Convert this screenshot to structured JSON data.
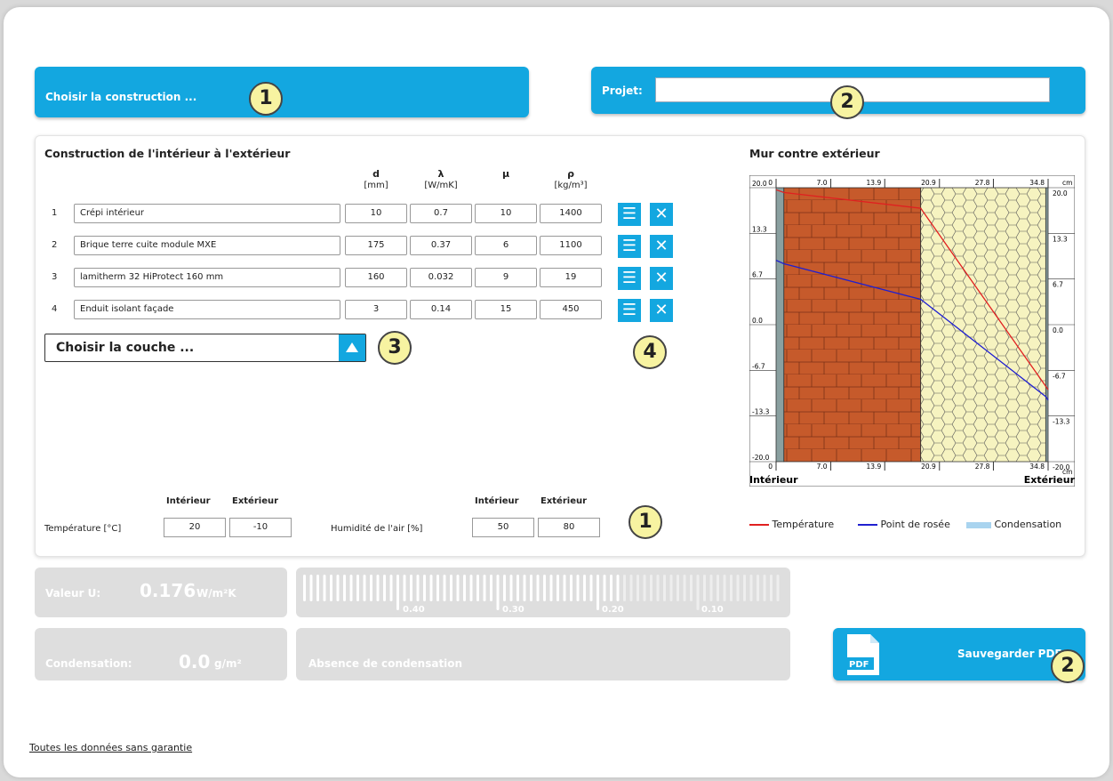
{
  "colors": {
    "accent": "#13a7e0",
    "badge": "#f7f3a1",
    "brick": "#c65a2b",
    "insulation": "#f6f3c0",
    "temperature_line": "#e02020",
    "dewpoint_line": "#2020d0"
  },
  "header": {
    "construction_label": "Choisir la construction ...",
    "projet_label": "Projet:",
    "projet_value": ""
  },
  "construction": {
    "title": "Construction de l'intérieur à l'extérieur",
    "columns": [
      {
        "symbol": "d",
        "unit": "[mm]"
      },
      {
        "symbol": "λ",
        "unit": "[W/mK]"
      },
      {
        "symbol": "µ",
        "unit": ""
      },
      {
        "symbol": "ρ",
        "unit": "[kg/m³]"
      }
    ],
    "layers": [
      {
        "num": "1",
        "name": "Crépi intérieur",
        "d": "10",
        "lambda": "0.7",
        "mu": "10",
        "rho": "1400"
      },
      {
        "num": "2",
        "name": "Brique terre cuite module MXE",
        "d": "175",
        "lambda": "0.37",
        "mu": "6",
        "rho": "1100"
      },
      {
        "num": "3",
        "name": "lamitherm 32 HiProtect 160 mm",
        "d": "160",
        "lambda": "0.032",
        "mu": "9",
        "rho": "19"
      },
      {
        "num": "4",
        "name": "Enduit isolant façade",
        "d": "3",
        "lambda": "0.14",
        "mu": "15",
        "rho": "450"
      }
    ],
    "choose_layer_label": "Choisir la couche ...",
    "menu_icon": "menu-icon",
    "delete_icon": "close-icon"
  },
  "climate": {
    "temperature_label": "Température [°C]",
    "humidity_label": "Humidité de l'air [%]",
    "interior_label": "Intérieur",
    "exterior_label": "Extérieur",
    "temp_interior": "20",
    "temp_exterior": "-10",
    "hum_interior": "50",
    "hum_exterior": "80"
  },
  "badges": {
    "b1": "1",
    "b2": "2",
    "b3": "3",
    "b4": "4",
    "b5": "1",
    "b6": "2"
  },
  "chart_data": {
    "type": "line",
    "title": "Mur contre extérieur",
    "x_unit": "cm",
    "x_ticks": [
      "0",
      "7.0",
      "13.9",
      "20.9",
      "27.8",
      "34.8"
    ],
    "y_ticks": [
      "20.0",
      "13.3",
      "6.7",
      "0.0",
      "-6.7",
      "-13.3",
      "-20.0"
    ],
    "xlim": [
      0,
      34.8
    ],
    "ylim": [
      -20,
      20
    ],
    "left_label": "Intérieur",
    "right_label": "Extérieur",
    "layers_x": [
      [
        0,
        1.0
      ],
      [
        1.0,
        18.5
      ],
      [
        18.5,
        34.5
      ],
      [
        34.5,
        34.8
      ]
    ],
    "series": [
      {
        "name": "Température",
        "x": [
          0,
          1.0,
          18.5,
          34.5,
          34.8
        ],
        "values": [
          19.7,
          19.3,
          17.0,
          -9.0,
          -9.5
        ]
      },
      {
        "name": "Point de rosée",
        "x": [
          0,
          1.0,
          18.5,
          34.5,
          34.8
        ],
        "values": [
          9.4,
          8.9,
          3.7,
          -10.5,
          -11.0
        ]
      }
    ],
    "legend": [
      "Température",
      "Point de rosée",
      "Condensation"
    ]
  },
  "results": {
    "u_label": "Valeur U:",
    "u_value": "0.176",
    "u_unit": "W/m²K",
    "scale_labels": [
      "0.40",
      "0.30",
      "0.20",
      "0.10"
    ],
    "condensation_label": "Condensation:",
    "condensation_value": "0.0",
    "condensation_unit": "g/m²",
    "condensation_status": "Absence de condensation"
  },
  "pdf": {
    "label": "Sauvegarder PDF",
    "icon_text": "PDF"
  },
  "footer": {
    "link": "Toutes les données sans garantie"
  }
}
